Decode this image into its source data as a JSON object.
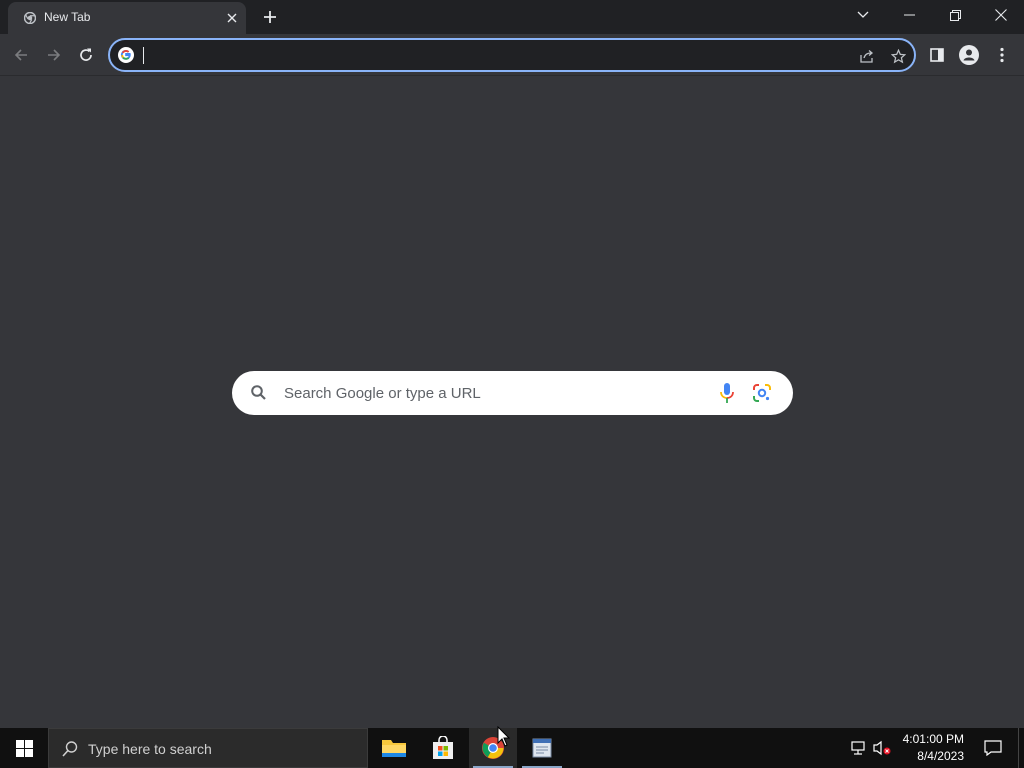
{
  "browser": {
    "tab": {
      "title": "New Tab",
      "favicon": "chrome-icon",
      "close_icon": "close-icon"
    },
    "new_tab_icon": "plus-icon",
    "window_controls": [
      "tab-search-icon",
      "minimize-icon",
      "restore-icon",
      "close-icon"
    ]
  },
  "toolbar": {
    "back_icon": "arrow-left-icon",
    "forward_icon": "arrow-right-icon",
    "reload_icon": "reload-icon",
    "omnibox": {
      "value": "",
      "placeholder": "",
      "leading_icon": "google-g-icon",
      "share_icon": "share-icon",
      "bookmark_icon": "star-icon"
    },
    "side_panel_icon": "side-panel-icon",
    "profile_icon": "profile-icon",
    "menu_icon": "kebab-menu-icon"
  },
  "ntp": {
    "search_placeholder": "Search Google or type a URL",
    "search_icon": "search-icon",
    "voice_icon": "microphone-icon",
    "lens_icon": "google-lens-icon"
  },
  "taskbar": {
    "search_placeholder": "Type here to search",
    "apps": [
      {
        "name": "File Explorer",
        "icon": "folder-icon"
      },
      {
        "name": "Microsoft Store",
        "icon": "store-icon"
      },
      {
        "name": "Google Chrome",
        "icon": "chrome-icon",
        "active": true
      },
      {
        "name": "Application",
        "icon": "app-window-icon"
      }
    ],
    "tray": {
      "network_icon": "network-icon",
      "volume_icon": "volume-muted-icon"
    },
    "clock": {
      "time": "4:01:00 PM",
      "date": "8/4/2023"
    }
  },
  "colors": {
    "titlebar": "#202124",
    "toolbar": "#35363a",
    "omnibox_bg": "#202124",
    "focus_ring": "#8ab4f8",
    "ntp_bg": "#35363a",
    "taskbar": "#101010"
  }
}
